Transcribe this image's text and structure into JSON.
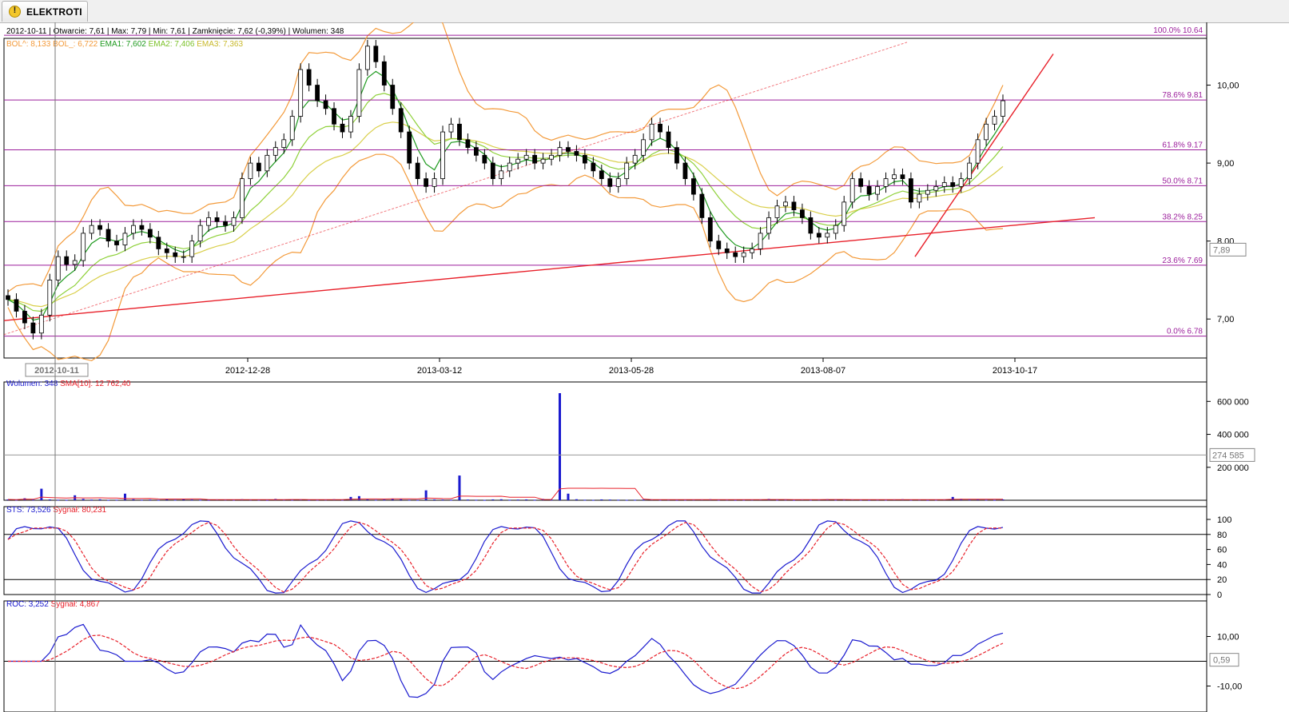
{
  "tab": {
    "title": "ELEKTROTI"
  },
  "colors": {
    "bollinger": "#f39a3a",
    "ema1": "#1f9a1f",
    "ema2": "#8fd13a",
    "ema3": "#d9cf4a",
    "fib_line": "#9c1f9c",
    "trend_line": "#e8202a",
    "volume": "#1a1acf",
    "signal": "#e8202a",
    "candle_up": "#ffffff",
    "candle_down": "#000000"
  },
  "header": {
    "date": "2012-10-11",
    "open": "Otwarcie: 7,61",
    "max": "Max: 7,79",
    "min": "Min: 7,61",
    "close": "Zamknięcie: 7,62 (-0,39%)",
    "volume": "Wolumen: 348",
    "bol_upper": "BOL^: 8,133",
    "bol_lower": "BOL_: 6,722",
    "ema1": "EMA1: 7,602",
    "ema2": "EMA2: 7,406",
    "ema3": "EMA3: 7,363"
  },
  "x_axis": {
    "cursor_label": "2012-10-11",
    "ticks": [
      "2012-12-28",
      "2013-03-12",
      "2013-05-28",
      "2013-08-07",
      "2013-10-17"
    ]
  },
  "chart_data": [
    {
      "type": "candlestick",
      "name": "price",
      "ylim": [
        6.5,
        10.6
      ],
      "y_ticks": [
        "7,00",
        "8,00",
        "9,00",
        "10,00"
      ],
      "current_value_label": "7,89",
      "fibonacci": [
        {
          "label": "100.0% 10.64",
          "value": 10.64
        },
        {
          "label": "78.6% 9.81",
          "value": 9.81
        },
        {
          "label": "61.8% 9.17",
          "value": 9.17
        },
        {
          "label": "50.0% 8.71",
          "value": 8.71
        },
        {
          "label": "38.2% 8.25",
          "value": 8.25
        },
        {
          "label": "23.6% 7.69",
          "value": 7.69
        },
        {
          "label": "0.0% 6.78",
          "value": 6.78
        }
      ],
      "close": [
        7.25,
        7.1,
        6.95,
        6.82,
        7.05,
        7.5,
        7.8,
        7.7,
        7.75,
        8.1,
        8.2,
        8.15,
        8.0,
        7.95,
        8.1,
        8.2,
        8.15,
        8.05,
        7.9,
        7.85,
        7.8,
        7.8,
        8.0,
        8.2,
        8.3,
        8.25,
        8.2,
        8.3,
        8.8,
        9.0,
        8.9,
        9.1,
        9.2,
        9.3,
        9.6,
        10.2,
        10.0,
        9.8,
        9.7,
        9.5,
        9.4,
        9.6,
        10.2,
        10.5,
        10.3,
        10.0,
        9.7,
        9.4,
        9.0,
        8.8,
        8.7,
        8.8,
        9.4,
        9.5,
        9.3,
        9.2,
        9.1,
        9.0,
        8.8,
        8.9,
        9.0,
        9.05,
        9.1,
        9.0,
        9.05,
        9.1,
        9.2,
        9.15,
        9.1,
        9.0,
        8.9,
        8.8,
        8.7,
        8.8,
        9.0,
        9.1,
        9.3,
        9.5,
        9.4,
        9.2,
        9.0,
        8.8,
        8.6,
        8.3,
        8.0,
        7.9,
        7.85,
        7.8,
        7.85,
        7.9,
        8.1,
        8.3,
        8.45,
        8.5,
        8.4,
        8.3,
        8.1,
        8.05,
        8.1,
        8.2,
        8.5,
        8.8,
        8.7,
        8.6,
        8.7,
        8.8,
        8.85,
        8.8,
        8.5,
        8.6,
        8.65,
        8.7,
        8.75,
        8.7,
        8.8,
        9.0,
        9.3,
        9.5,
        9.6,
        9.8
      ],
      "volume": {
        "y_ticks": [
          "200 000",
          "400 000",
          "600 000"
        ],
        "current_value_label": "274 585",
        "ylim": [
          0,
          650000
        ],
        "values": [
          5000,
          3000,
          12000,
          4000,
          70000,
          5000,
          3000,
          2000,
          30000,
          8000,
          4000,
          6000,
          2000,
          3000,
          40000,
          6000,
          3000,
          4000,
          2000,
          5000,
          3000,
          6000,
          4000,
          3000,
          2000,
          5000,
          4000,
          3000,
          6000,
          4000,
          3000,
          2000,
          8000,
          4000,
          3000,
          5000,
          2000,
          3000,
          4000,
          6000,
          3000,
          20000,
          25000,
          5000,
          3000,
          4000,
          8000,
          6000,
          3000,
          2000,
          60000,
          5000,
          4000,
          3000,
          150000,
          4000,
          3000,
          2000,
          5000,
          6000,
          3000,
          4000,
          5000,
          3000,
          8000,
          4000,
          650000,
          40000,
          6000,
          3000,
          2000,
          5000,
          4000,
          3000,
          2000,
          3000,
          4000,
          5000,
          3000,
          4000,
          2000,
          3000,
          4000,
          5000,
          6000,
          3000,
          4000,
          2000,
          3000,
          4000,
          5000,
          8000,
          3000,
          4000,
          2000,
          5000,
          3000,
          4000,
          6000,
          3000,
          4000,
          5000,
          3000,
          2000,
          4000,
          3000,
          5000,
          6000,
          3000,
          4000,
          2000,
          3000,
          5000,
          20000,
          8000,
          4000,
          6000,
          3000,
          2000,
          5000
        ],
        "sma_label": "SMA[10]: 12 762,40",
        "series_label": "Wolumen: 348"
      },
      "sts": {
        "series_label": "STS: 73,526",
        "signal_label": "Sygnał: 80,231",
        "y_ticks": [
          "0",
          "20",
          "40",
          "60",
          "80",
          "100"
        ],
        "levels": [
          20,
          80
        ]
      },
      "roc": {
        "series_label": "ROC: 3,252",
        "signal_label": "Sygnał: 4,867",
        "y_ticks": [
          "10,00",
          "-10,00"
        ],
        "current_value_label": "0,59"
      }
    }
  ]
}
